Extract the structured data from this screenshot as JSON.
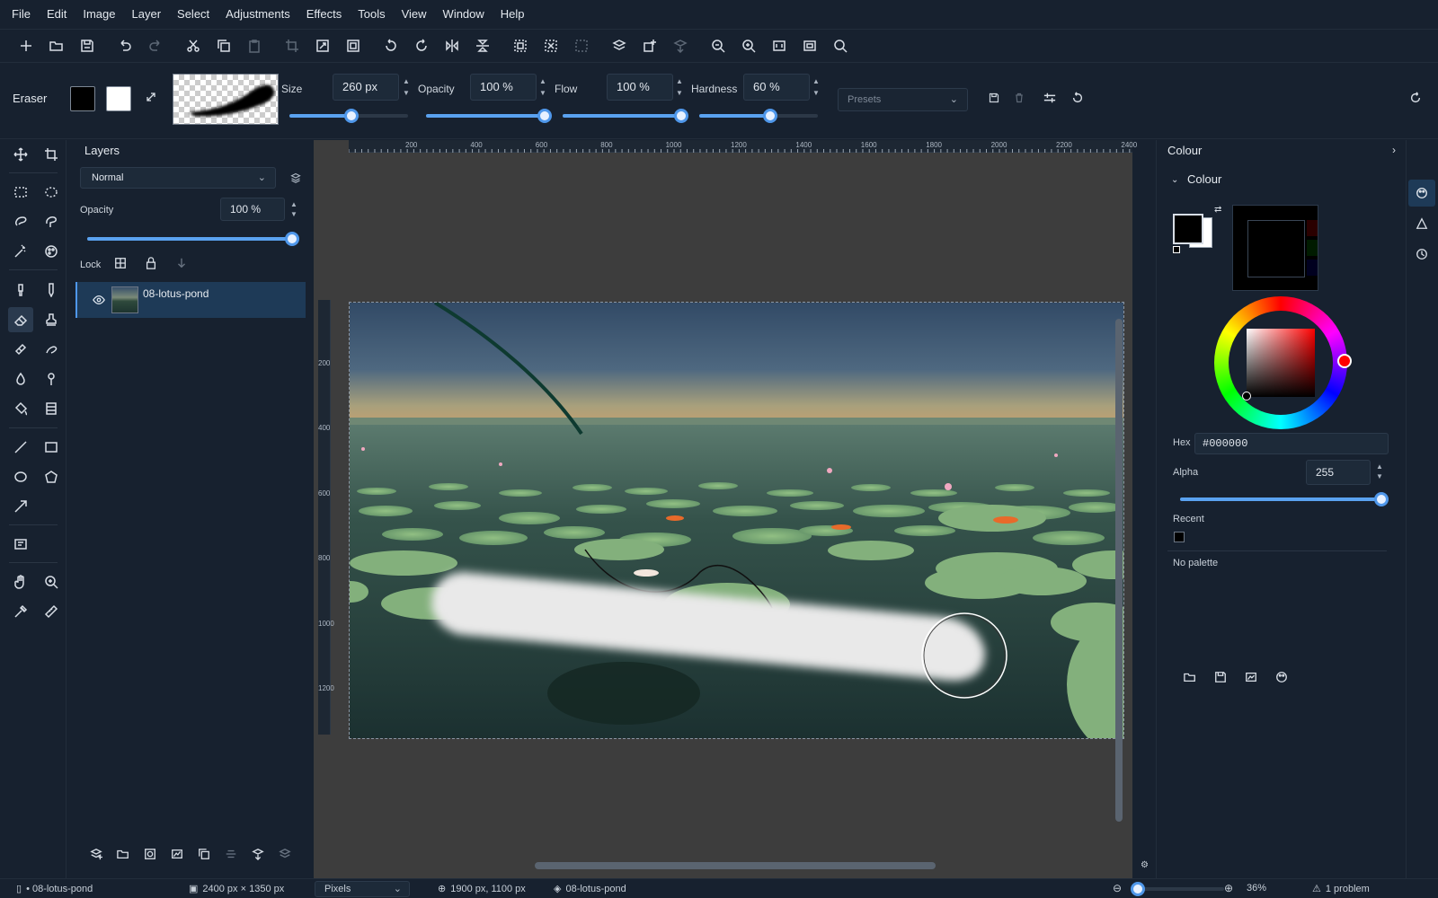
{
  "menu": [
    "File",
    "Edit",
    "Image",
    "Layer",
    "Select",
    "Adjustments",
    "Effects",
    "Tools",
    "View",
    "Window",
    "Help"
  ],
  "toolbar_icons": [
    "new-icon",
    "open-icon",
    "save-icon",
    "undo-icon",
    "redo-icon",
    "cut-icon",
    "copy-icon",
    "paste-icon",
    "crop-to-selection-icon",
    "resize-image-icon",
    "canvas-size-icon",
    "rotate-ccw-icon",
    "rotate-cw-icon",
    "flip-horizontal-icon",
    "flip-vertical-icon",
    "select-all-icon",
    "deselect-icon",
    "invert-selection-icon",
    "flatten-icon",
    "add-layer-icon",
    "merge-layer-icon",
    "zoom-out-icon",
    "zoom-in-icon",
    "actual-size-icon",
    "best-fit-icon",
    "search-icon"
  ],
  "options": {
    "tool_name": "Eraser",
    "size_label": "Size",
    "size_value": "260 px",
    "opacity_label": "Opacity",
    "opacity_value": "100 %",
    "flow_label": "Flow",
    "flow_value": "100 %",
    "hardness_label": "Hardness",
    "hardness_value": "60 %",
    "presets_placeholder": "Presets",
    "size_fraction": 0.52,
    "opacity_fraction": 1.0,
    "flow_fraction": 1.0,
    "hardness_fraction": 0.6
  },
  "layers": {
    "title": "Layers",
    "blend_mode": "Normal",
    "opacity_label": "Opacity",
    "opacity_value": "100 %",
    "opacity_fraction": 1.0,
    "lock_label": "Lock",
    "items": [
      {
        "name": "08-lotus-pond",
        "visible": true
      }
    ]
  },
  "ruler": {
    "h_ticks": [
      "200",
      "400",
      "600",
      "800",
      "1000",
      "1200",
      "1400",
      "1600",
      "1800",
      "2000",
      "2200",
      "2400"
    ],
    "v_ticks": [
      "200",
      "400",
      "600",
      "800",
      "1000",
      "1200"
    ]
  },
  "colour": {
    "panel_title": "Colour",
    "section_title": "Colour",
    "hex_label": "Hex",
    "hex_value": "#000000",
    "alpha_label": "Alpha",
    "alpha_value": "255",
    "alpha_fraction": 1.0,
    "recent_label": "Recent",
    "no_palette": "No palette",
    "primary": "#000000",
    "secondary": "#ffffff"
  },
  "status": {
    "document": "• 08-lotus-pond",
    "image_size": "2400 px × 1350 px",
    "units": "Pixels",
    "cursor_pos": "1900 px, 1100 px",
    "layer": "08-lotus-pond",
    "zoom": "36%",
    "problems": "1 problem"
  },
  "colors": {
    "accent": "#4f97ea",
    "bg": "#17212f",
    "canvas_bg": "#3d3d3d"
  }
}
